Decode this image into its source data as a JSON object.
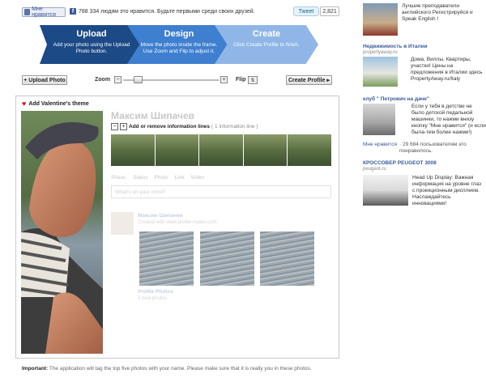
{
  "social": {
    "like_label": "Мне нравится",
    "fb_text": "788 334 людям это нравится. Будьте первыми среди своих друзей.",
    "tweet_label": "Tweet",
    "tweet_count": "2,821"
  },
  "steps": [
    {
      "title": "Upload",
      "desc": "Add your photo using the Upload Photo button."
    },
    {
      "title": "Design",
      "desc": "Move the photo inside the frame. Use Zoom and Flip to adjust it."
    },
    {
      "title": "Create",
      "desc": "Click Create Profile to finish."
    }
  ],
  "toolbar": {
    "upload_label": "+ Upload Photo",
    "zoom_label": "Zoom",
    "zoom_minus": "−",
    "zoom_plus": "+",
    "zoom_level": 0.12,
    "flip_label": "Flip",
    "create_label": "Create Profile ▸"
  },
  "editor": {
    "valentine_label": "Add Valentine's theme",
    "profile_name": "Максим Шипачев",
    "info_minus": "−",
    "info_plus": "+",
    "info_action": "Add or remove information lines",
    "info_count": "( 1 information line )",
    "share_label": "Share:",
    "share_items": [
      "Status",
      "Photo",
      "Link",
      "Video"
    ],
    "mind_placeholder": "What's on your mind?",
    "post_name": "Максим Шипачев",
    "post_sub": "Created with www.profile-maker.com.",
    "photos_label": "Profile Photos",
    "photos_sub": "3 new photos",
    "important_label": "Important:",
    "important_text": "The application will tag the top five photos with your name. Please make sure that it is really you in these photos."
  },
  "ads": [
    {
      "text": "Лучшие преподаватели английского Регистрируйся и Speak English !"
    },
    {
      "title": "Недвижимость в Италии",
      "sub": "propertyaway.ru",
      "text": "Дома, Виллы, Квартиры, участки! Цены на предложения в Италии здесь PropertyAway.ru/Italy"
    },
    {
      "title": "клуб \" Петрович на даче\"",
      "text": "Если у тебя в детстве не было детской педальной машинки, то нажми внизу кнопку \"Мне нравится\" (и если была-тем более нажми!)",
      "like_label": "Мне нравится",
      "like_text": "· 29 684 пользователям это понравилось."
    },
    {
      "title": "КРОССОВЕР PEUGEOT 3008",
      "sub": "peugeot.ru",
      "text": "Head Up Display: Важная информация на уровне глаз с проекционным дисплеем. Наслаждайтесь инновациями!"
    }
  ],
  "colors": {
    "step1": "#1c4a86",
    "step2": "#3f7fcf",
    "step3": "#8fb6e6",
    "link": "#3b5998",
    "heart": "#d0141b"
  }
}
